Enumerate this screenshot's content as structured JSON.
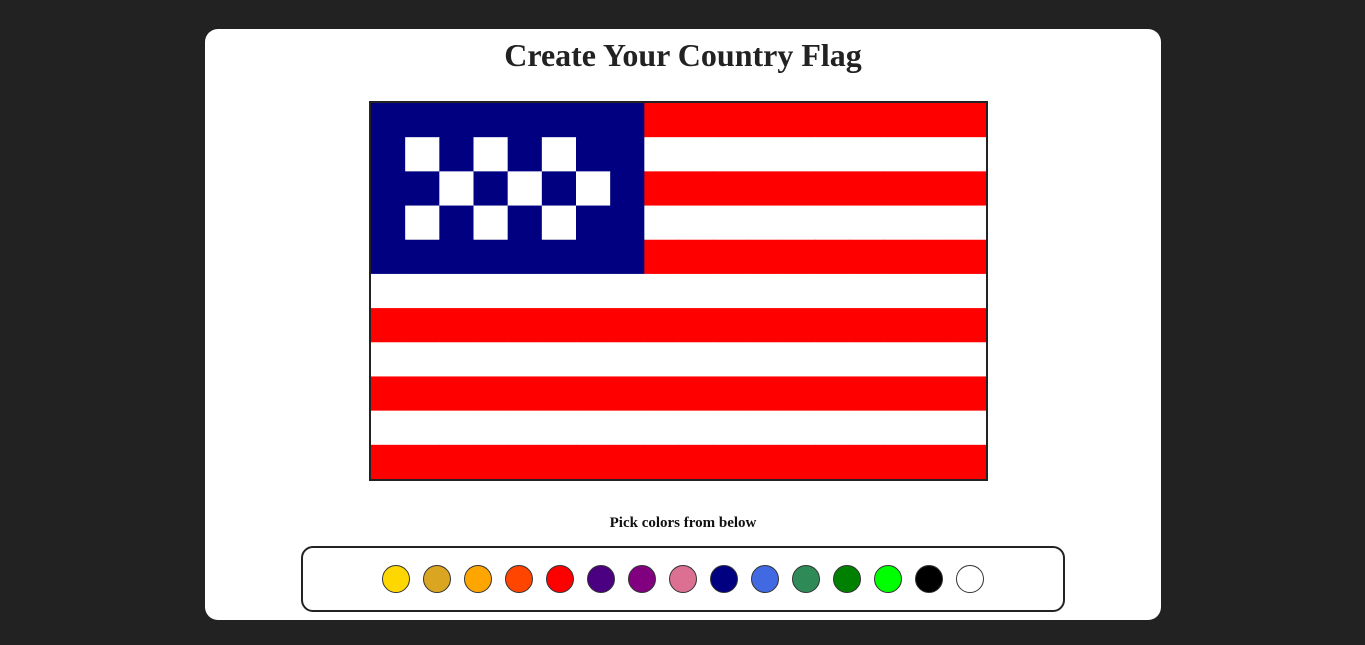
{
  "page": {
    "title": "Create Your Country Flag",
    "pick_label": "Pick colors from below"
  },
  "flag": {
    "rows": 11,
    "cols": 18,
    "canton_color": "#000080",
    "stripe_red": "#ff0000",
    "stripe_white": "#ffffff",
    "cells": [
      "BBBBBBBBRRRRRRRRRR",
      "BWBWBWBBWWWWWWWWWW",
      "BBWBWBWBRRRRRRRRRR",
      "BWBWBWBBWWWWWWWWWW",
      "BBBBBBBBRRRRRRRRRR",
      "WWWWWWWWWWWWWWWWWW",
      "RRRRRRRRRRRRRRRRRR",
      "WWWWWWWWWWWWWWWWWW",
      "RRRRRRRRRRRRRRRRRR",
      "WWWWWWWWWWWWWWWWWW",
      "RRRRRRRRRRRRRRRRRR"
    ],
    "legend": {
      "B": "#000080",
      "R": "#ff0000",
      "W": "#ffffff"
    }
  },
  "palette": {
    "colors": [
      "#ffd700",
      "#daa520",
      "#ffa500",
      "#ff4500",
      "#ff0000",
      "#4b0082",
      "#800080",
      "#db7093",
      "#000080",
      "#4169e1",
      "#2e8b57",
      "#008000",
      "#00ff00",
      "#000000",
      "#ffffff"
    ]
  }
}
